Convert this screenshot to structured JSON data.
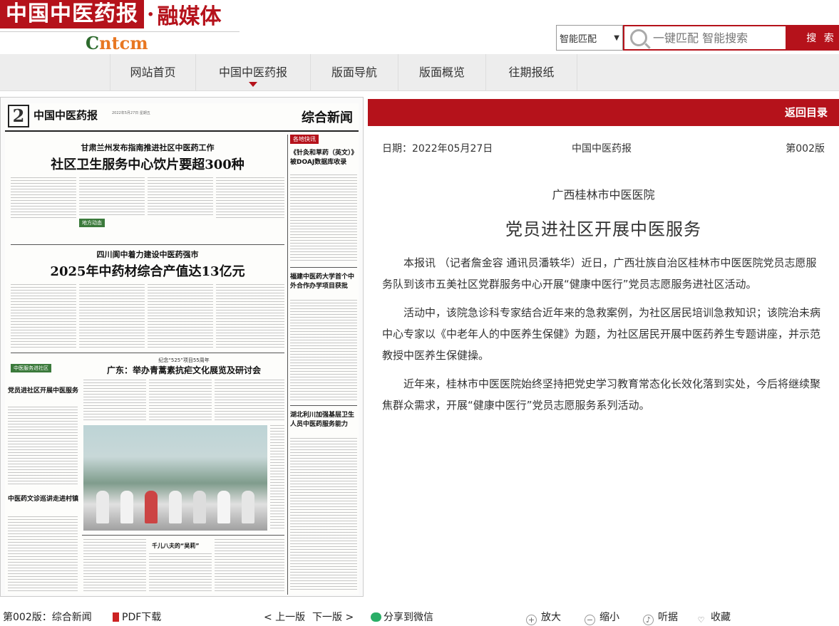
{
  "header": {
    "logo_main": "中国中医药报",
    "logo_dot": "·",
    "logo_sub": "融媒体",
    "logo_brand_a": "C",
    "logo_brand_b": "ntcm"
  },
  "search": {
    "mode": "智能匹配",
    "placeholder": "一键匹配 智能搜索",
    "button": "搜 索"
  },
  "nav": {
    "items": [
      {
        "label": "网站首页"
      },
      {
        "label": "中国中医药报",
        "active": true
      },
      {
        "label": "版面导航"
      },
      {
        "label": "版面概览"
      },
      {
        "label": "往期报纸"
      }
    ]
  },
  "newspaper": {
    "page_num": "2",
    "brand": "中国中医药报",
    "date_line": "2022年5月27日 星期五",
    "section": "综合新闻",
    "headline1_sub": "甘肃兰州发布指南推进社区中医药工作",
    "headline1": "社区卫生服务中心饮片要超300种",
    "headline2_sub": "四川阆中着力建设中医药强市",
    "headline2": "2025年中药材综合产值达13亿元",
    "headline3_kicker": "纪念“525”项目55周年",
    "headline3": "广东：举办青蒿素抗疟文化展览及研讨会",
    "side1": "《针灸和草药（英文）》被DOAJ数据库收录",
    "side2": "福建中医药大学首个中外合作办学项目获批",
    "side3": "湖北利川加强基层卫生人员中医药服务能力",
    "left_col1_tag": "中医服务进社区",
    "left_col1_title": "党员进社区开展中医服务",
    "left_col2_title": "中医药文诊巡讲走进村镇",
    "mid_small": "千儿八夫的“吴莉”"
  },
  "article": {
    "back_label": "返回目录",
    "date": "日期：2022年05月27日",
    "paper": "中国中医药报",
    "page": "第002版",
    "subtitle": "广西桂林市中医医院",
    "title": "党员进社区开展中医服务",
    "paragraphs": [
      "本报讯 （记者詹金容 通讯员潘轶华）近日，广西壮族自治区桂林市中医医院党员志愿服务队到该市五美社区党群服务中心开展“健康中医行”党员志愿服务进社区活动。",
      "活动中，该院急诊科专家结合近年来的急救案例，为社区居民培训急救知识；该院治未病中心专家以《中老年人的中医养生保健》为题，为社区居民开展中医药养生专题讲座，并示范教授中医养生保健操。",
      "近年来，桂林市中医医院始终坚持把党史学习教育常态化长效化落到实处，今后将继续聚焦群众需求，开展“健康中医行”党员志愿服务系列活动。"
    ]
  },
  "bottom": {
    "page_label": "第002版：综合新闻",
    "pdf_label": "PDF下载",
    "prev": "< 上一版",
    "next": "下一版 >",
    "share": "分享到微信",
    "zoom_in": "放大",
    "zoom_out": "缩小",
    "listen": "听据",
    "favorite": "收藏"
  },
  "colors": {
    "brand_red": "#b5121b",
    "nav_bg": "#ededed"
  }
}
